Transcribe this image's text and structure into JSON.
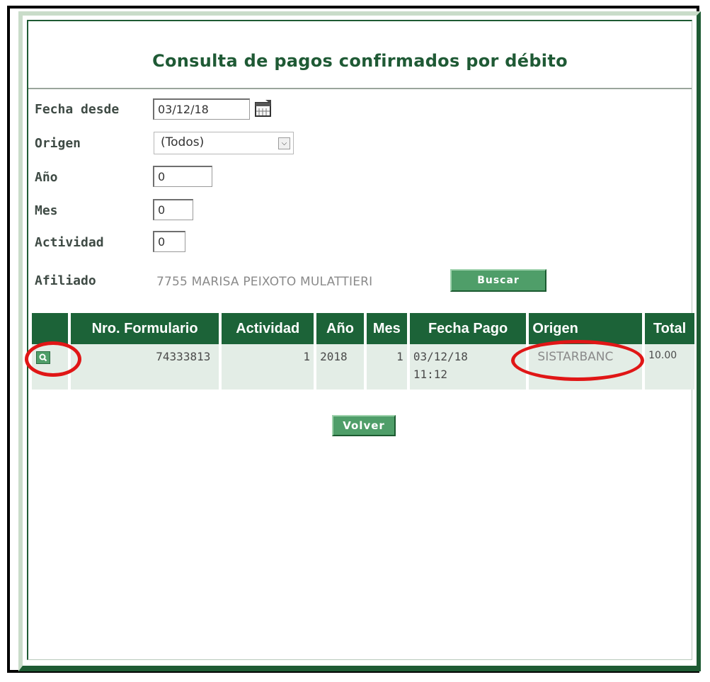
{
  "title": "Consulta de pagos confirmados por débito",
  "form": {
    "fecha_desde": {
      "label": "Fecha desde",
      "value": "03/12/18"
    },
    "origen": {
      "label": "Origen",
      "value": "(Todos)"
    },
    "anio": {
      "label": "Año",
      "value": "0"
    },
    "mes": {
      "label": "Mes",
      "value": "0"
    },
    "actividad": {
      "label": "Actividad",
      "value": "0"
    },
    "afiliado": {
      "label": "Afiliado",
      "value": "7755  MARISA PEIXOTO MULATTIERI"
    },
    "buscar_label": "Buscar"
  },
  "table": {
    "headers": [
      "",
      "Nro. Formulario",
      "Actividad",
      "Año",
      "Mes",
      "Fecha Pago",
      "Origen",
      "Total"
    ],
    "rows": [
      {
        "nro_formulario": "74333813",
        "actividad": "1",
        "anio": "2018",
        "mes": "1",
        "fecha_pago_date": "03/12/18",
        "fecha_pago_time": "11:12",
        "origen": "SISTARBANC",
        "total": "10.00"
      }
    ]
  },
  "volver_label": "Volver",
  "icons": {
    "calendar": "calendar-icon",
    "view": "magnifier-icon",
    "dropdown": "chevron-down-icon"
  },
  "colors": {
    "primary_green": "#1c6338",
    "button_green": "#4f9e69",
    "row_bg": "#e3ede6",
    "highlight_red": "#e01616"
  }
}
